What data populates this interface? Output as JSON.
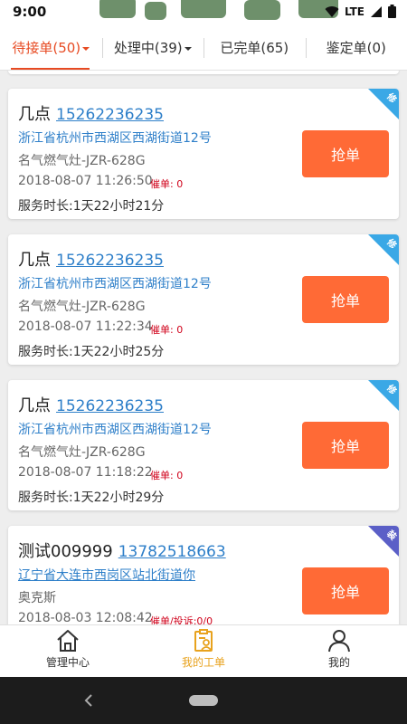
{
  "status_bar": {
    "time": "9:00",
    "network": "LTE",
    "icons": [
      "wifi-icon",
      "signal-icon",
      "battery-icon"
    ]
  },
  "tabs": [
    {
      "label": "待接单(50)",
      "active": true,
      "dropdown": true
    },
    {
      "label": "处理中(39)",
      "active": false,
      "dropdown": true
    },
    {
      "label": "已完单(65)",
      "active": false,
      "dropdown": false
    },
    {
      "label": "鉴定单(0)",
      "active": false,
      "dropdown": false
    }
  ],
  "orders": [
    {
      "name": "几点",
      "phone": "15262236235",
      "address": "浙江省杭州市西湖区西湖街道12号",
      "product": "名气燃气灶-JZR-628G",
      "time": "2018-08-07 11:26:50",
      "urge": "催单: 0",
      "duration": "服务时长:1天22小时21分",
      "button": "抢单",
      "corner_label": "修",
      "corner_color": "#3aa8e6"
    },
    {
      "name": "几点",
      "phone": "15262236235",
      "address": "浙江省杭州市西湖区西湖街道12号",
      "product": "名气燃气灶-JZR-628G",
      "time": "2018-08-07 11:22:34",
      "urge": "催单: 0",
      "duration": "服务时长:1天22小时25分",
      "button": "抢单",
      "corner_label": "修",
      "corner_color": "#3aa8e6"
    },
    {
      "name": "几点",
      "phone": "15262236235",
      "address": "浙江省杭州市西湖区西湖街道12号",
      "product": "名气燃气灶-JZR-628G",
      "time": "2018-08-07 11:18:22",
      "urge": "催单: 0",
      "duration": "服务时长:1天22小时29分",
      "button": "抢单",
      "corner_label": "修",
      "corner_color": "#3aa8e6"
    },
    {
      "name": "测试009999",
      "phone": "13782518663",
      "address": "辽宁省大连市西岗区站北街道你",
      "product": "奥克斯",
      "time": "2018-08-03 12:08:42",
      "urge": "催单/投诉:0/0",
      "duration": "",
      "button": "抢单",
      "corner_label": "装",
      "corner_color": "#5b5fc7"
    }
  ],
  "bottom_nav": [
    {
      "label": "管理中心",
      "icon": "home-icon",
      "active": false
    },
    {
      "label": "我的工单",
      "icon": "work-order-icon",
      "active": true
    },
    {
      "label": "我的",
      "icon": "person-icon",
      "active": false
    }
  ],
  "colors": {
    "accent": "#e74a22",
    "button": "#ff6a36",
    "link": "#2e7fc9",
    "nav_active": "#e8a21d"
  }
}
